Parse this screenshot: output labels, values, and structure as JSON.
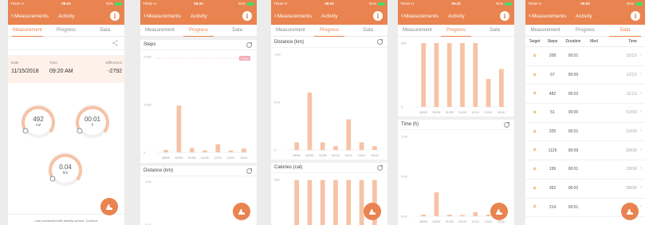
{
  "status": {
    "carrier": "TRUE-H",
    "battery": "91%",
    "times": [
      "09:03",
      "09:20",
      "09:20",
      "09:20",
      "09:20"
    ]
  },
  "nav": {
    "back_label": "Measurements",
    "title": "Activity",
    "info": "i"
  },
  "tabs": [
    "Measurement",
    "Progress",
    "Data"
  ],
  "measurement": {
    "date_label": "Date",
    "date_value": "11/15/2018",
    "time_label": "Time",
    "time_value": "09:20 AM",
    "diff_label": "Difference",
    "diff_value": "-2792",
    "gauges": [
      {
        "value": "492",
        "unit": "cal",
        "fill": 0.35
      },
      {
        "value": "00:01",
        "unit": "h",
        "fill": 0.28
      },
      {
        "value": "0.04",
        "unit": "km",
        "fill": 0.3
      }
    ],
    "footer": "Last connected with activity sensor: Connect"
  },
  "colors": {
    "accent": "#e9834f",
    "bar": "#f6c3a6",
    "target": "#f3a9b4"
  },
  "chart_data": [
    {
      "type": "bar",
      "title": "Steps",
      "categories": [
        "28/09/",
        "30/09/",
        "31/09/",
        "01/10/",
        "11/11/",
        "12/11/",
        "15/11/"
      ],
      "y_ticks": [
        "2,000",
        "1,500",
        "0"
      ],
      "target_label": "Target",
      "values": [
        50,
        980,
        90,
        40,
        170,
        40,
        80
      ],
      "ylim": [
        0,
        2000
      ]
    },
    {
      "type": "bar",
      "title": "Distance (km)",
      "categories": [
        "28/09/",
        "30/09/",
        "31/09/",
        "01/10/",
        "11/11/",
        "12/11/",
        "15/11/"
      ],
      "y_ticks": [
        "1.60",
        "0.01",
        "0"
      ],
      "values": [
        0.002,
        0.015,
        0.002,
        0.001,
        0.008,
        0.002,
        0.001
      ],
      "ylim": [
        0,
        0.025
      ]
    },
    {
      "type": "bar",
      "title": "Calories (cal)",
      "y_ticks": [
        "986",
        "490"
      ],
      "values": [
        990,
        990,
        990,
        990,
        990,
        990,
        990
      ],
      "ylim": [
        0,
        1000
      ]
    },
    {
      "type": "bar",
      "title": "Time (h)",
      "categories": [
        "28/09/",
        "30/09/",
        "31/09/",
        "01/10/",
        "11/11/",
        "12/11/",
        "15/11/"
      ],
      "y_ticks": [
        "1.00",
        "0.05",
        "0.00"
      ],
      "values": [
        0.002,
        0.03,
        0.002,
        0.001,
        0.005,
        0.002,
        0.001
      ],
      "ylim": [
        0,
        0.1
      ]
    },
    {
      "type": "bar",
      "title": "",
      "categories": [
        "28/09/",
        "30/09/",
        "31/09/",
        "01/10/",
        "11/11/",
        "12/11/",
        "15/11/"
      ],
      "y_ticks": [
        "480",
        "0"
      ],
      "values": [
        640,
        640,
        640,
        640,
        640,
        280,
        380
      ],
      "ylim": [
        0,
        640
      ]
    }
  ],
  "data_table": {
    "headers": [
      "Target",
      "Steps",
      "Duration",
      "Med",
      "Time"
    ],
    "rows": [
      {
        "target": "×",
        "steps": "208",
        "duration": "00:01",
        "med": "",
        "time": "15/11/"
      },
      {
        "target": "×",
        "steps": "67",
        "duration": "00:00",
        "med": "",
        "time": "12/11/"
      },
      {
        "target": "×",
        "steps": "482",
        "duration": "00:02",
        "med": "",
        "time": "11/11/"
      },
      {
        "target": "×",
        "steps": "51",
        "duration": "00:00",
        "med": "",
        "time": "01/09/"
      },
      {
        "target": "×",
        "steps": "205",
        "duration": "00:01",
        "med": "",
        "time": "31/09/"
      },
      {
        "target": "×",
        "steps": "1126",
        "duration": "00:09",
        "med": "",
        "time": "30/09/"
      },
      {
        "target": "×",
        "steps": "199",
        "duration": "00:01",
        "med": "",
        "time": "29/09/"
      },
      {
        "target": "×",
        "steps": "352",
        "duration": "00:02",
        "med": "",
        "time": "28/09/"
      },
      {
        "target": "×",
        "steps": "214",
        "duration": "00:01",
        "med": "",
        "time": "27/09/"
      }
    ]
  }
}
